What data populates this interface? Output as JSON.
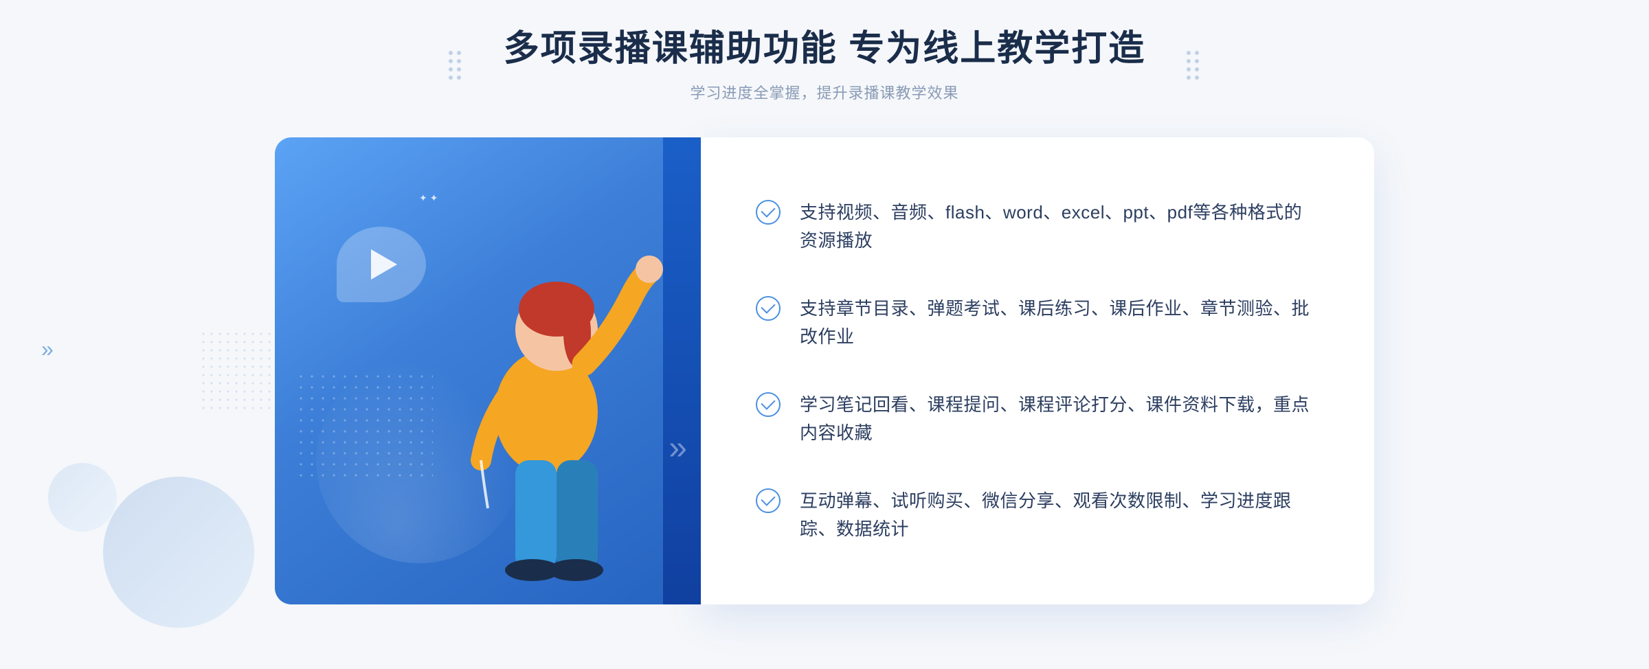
{
  "header": {
    "main_title": "多项录播课辅助功能 专为线上教学打造",
    "sub_title": "学习进度全掌握，提升录播课教学效果"
  },
  "features": [
    {
      "id": "feature-1",
      "text": "支持视频、音频、flash、word、excel、ppt、pdf等各种格式的资源播放"
    },
    {
      "id": "feature-2",
      "text": "支持章节目录、弹题考试、课后练习、课后作业、章节测验、批改作业"
    },
    {
      "id": "feature-3",
      "text": "学习笔记回看、课程提问、课程评论打分、课件资料下载，重点内容收藏"
    },
    {
      "id": "feature-4",
      "text": "互动弹幕、试听购买、微信分享、观看次数限制、学习进度跟踪、数据统计"
    }
  ],
  "colors": {
    "primary_blue": "#4a90e2",
    "dark_blue": "#1a5fc8",
    "gradient_start": "#5ba3f5",
    "gradient_end": "#2563c0",
    "text_dark": "#1a2d4a",
    "text_light": "#8a9bb5",
    "feature_text": "#2c3e60"
  }
}
